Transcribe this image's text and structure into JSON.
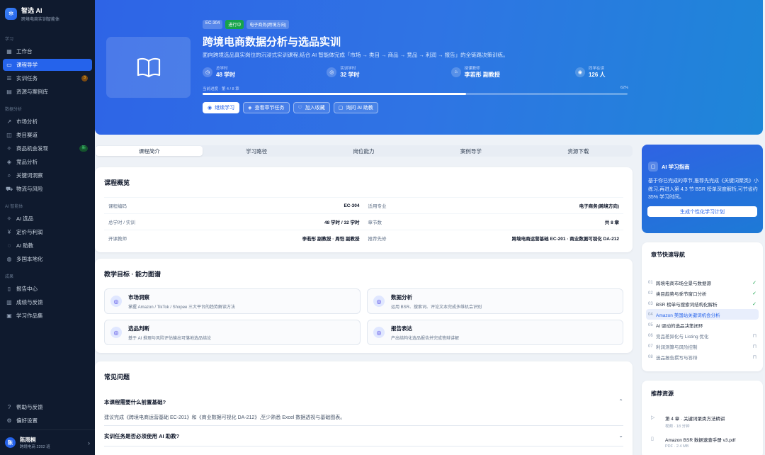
{
  "brand": {
    "name": "智选 AI",
    "subtitle": "跨境电商实训智能体"
  },
  "nav": {
    "sections": [
      {
        "title": "学习",
        "items": [
          {
            "label": "工作台",
            "icon": "grid-icon"
          },
          {
            "label": "课程导学",
            "icon": "book-icon",
            "active": true
          },
          {
            "label": "实训任务",
            "icon": "list-icon",
            "badge": "3"
          },
          {
            "label": "资源与案例库",
            "icon": "folder-icon"
          }
        ]
      },
      {
        "title": "数据分析",
        "items": [
          {
            "label": "市场分析",
            "icon": "trend-icon"
          },
          {
            "label": "类目赛道",
            "icon": "category-icon"
          },
          {
            "label": "商品机会发现",
            "icon": "sparkle-icon",
            "badge": "新"
          },
          {
            "label": "竞品分析",
            "icon": "layers-icon"
          },
          {
            "label": "关键词洞察",
            "icon": "search-icon"
          },
          {
            "label": "物流与风险",
            "icon": "truck-icon"
          }
        ]
      },
      {
        "title": "AI 智能体",
        "items": [
          {
            "label": "AI 选品",
            "icon": "sparkle-icon"
          },
          {
            "label": "定价与利润",
            "icon": "price-icon"
          },
          {
            "label": "AI 助教",
            "icon": "chat-icon"
          },
          {
            "label": "多国本地化",
            "icon": "globe-icon"
          }
        ]
      },
      {
        "title": "成果",
        "items": [
          {
            "label": "报告中心",
            "icon": "doc-icon"
          },
          {
            "label": "成绩与反馈",
            "icon": "chart-icon"
          },
          {
            "label": "学习作品集",
            "icon": "portfolio-icon"
          }
        ]
      }
    ],
    "bottom": [
      {
        "label": "帮助与反馈",
        "icon": "help-icon"
      },
      {
        "label": "偏好设置",
        "icon": "gear-icon"
      }
    ]
  },
  "user": {
    "initial": "陈",
    "name": "陈雨桐",
    "sub": "跨境电商 2202 班"
  },
  "hero": {
    "tags": [
      "EC-304",
      "进行中",
      "电子商务(跨境方向)"
    ],
    "title": "跨境电商数据分析与选品实训",
    "desc": "面向跨境选品真实岗位的沉浸式实训课程,结合 AI 智能体完成「市场 → 类目 → 商品 → 竞品 → 利润 → 报告」的全链路决策训练。",
    "stats": [
      {
        "label": "总学时",
        "value": "48 学时",
        "icon": "clock-icon"
      },
      {
        "label": "实训学时",
        "value": "32 学时",
        "icon": "target-icon"
      },
      {
        "label": "授课教师",
        "value": "李若彤 副教授",
        "icon": "cap-icon"
      },
      {
        "label": "同学在读",
        "value": "126 人",
        "icon": "users-icon"
      }
    ],
    "progress_label": "当前进度 · 第 4 / 8 章",
    "progress_pct_text": "62%",
    "progress": 0.62,
    "actions": [
      {
        "label": "继续学习",
        "icon": "play-icon",
        "primary": true
      },
      {
        "label": "查看章节任务",
        "icon": "stack-icon"
      },
      {
        "label": "加入收藏",
        "icon": "heart-icon"
      },
      {
        "label": "询问 AI 助教",
        "icon": "robot-icon"
      }
    ]
  },
  "tabs": [
    "课程简介",
    "学习路径",
    "岗位能力",
    "案例导学",
    "资源下载"
  ],
  "overview": {
    "title": "课程概览",
    "rows": [
      [
        {
          "k": "课程编码",
          "v": "EC-304"
        },
        {
          "k": "适用专业",
          "v": "电子商务(跨境方向)"
        }
      ],
      [
        {
          "k": "总学时 / 实训",
          "v": "48 学时 / 32 学时"
        },
        {
          "k": "章节数",
          "v": "共 8 章"
        }
      ],
      [
        {
          "k": "开课教师",
          "v": "李若彤 副教授 · 周恺 副教授"
        },
        {
          "k": "推荐先修",
          "v": "跨境电商运营基础 EC-201 · 商业数据可视化 DA-212"
        }
      ]
    ]
  },
  "goals": {
    "title": "教学目标 · 能力图谱",
    "items": [
      {
        "title": "市场洞察",
        "desc": "掌握 Amazon / TikTok / Shopee 三大平台的趋势解读方法"
      },
      {
        "title": "数据分析",
        "desc": "运用 BSR、搜索词、评论文本完成多维机会识别"
      },
      {
        "title": "选品判断",
        "desc": "基于 AI 推理与风险评估输出可落地选品结论"
      },
      {
        "title": "报告表达",
        "desc": "产出结构化选品报告并完成答辩讲解"
      }
    ]
  },
  "faq": {
    "title": "常见问题",
    "items": [
      {
        "q": "本课程需要什么前置基础?",
        "a": "建议完成《跨境电商运营基础 EC-201》和《商业数据可视化 DA-212》,至少熟悉 Excel 数据透视与基础图表。"
      },
      {
        "q": "实训任务是否必须使用 AI 助教?",
        "a": ""
      }
    ]
  },
  "ai_guide": {
    "title": "AI 学习指南",
    "text": "基于你已完成的章节,推荐先完成《关键词聚类》小练习,再进入第 4.3 节 BSR 榜单深度解析,可节省约 35% 学习时间。",
    "cta": "生成个性化学习计划"
  },
  "chapters": {
    "title": "章节快速导航",
    "items": [
      {
        "n": "01",
        "label": "跨境电商市场全景与数据源",
        "status": "done"
      },
      {
        "n": "02",
        "label": "类目趋势与季节窗口分析",
        "status": "done"
      },
      {
        "n": "03",
        "label": "BSR 榜单与搜索词结构化解析",
        "status": "done"
      },
      {
        "n": "04",
        "label": "Amazon 美国站关键词机会分析",
        "status": "current"
      },
      {
        "n": "05",
        "label": "AI 驱动的选品决策闭环",
        "status": "open"
      },
      {
        "n": "06",
        "label": "竞品差异化与 Listing 优化",
        "status": "locked"
      },
      {
        "n": "07",
        "label": "利润测算与风险控制",
        "status": "locked"
      },
      {
        "n": "08",
        "label": "选品报告撰写与答辩",
        "status": "locked"
      }
    ]
  },
  "resources": {
    "title": "推荐资源",
    "items": [
      {
        "title": "第 4 章 · 关键词聚类方法精讲",
        "meta": "视频 · 18 分钟",
        "icon": "video-icon"
      },
      {
        "title": "Amazon BSR 数据速查手册 v3.pdf",
        "meta": "PDF · 2.4 MB",
        "icon": "file-icon"
      }
    ]
  }
}
